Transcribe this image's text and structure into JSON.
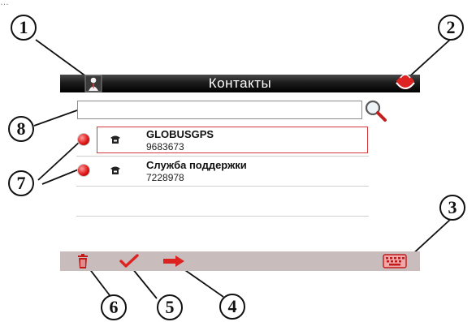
{
  "header": {
    "title": "Контакты",
    "cutoff_text": "…"
  },
  "search": {
    "value": "",
    "placeholder": ""
  },
  "contacts": [
    {
      "name": "GLOBUSGPS",
      "number": "9683673",
      "selected": true
    },
    {
      "name": "Служба поддержки",
      "number": "7228978",
      "selected": false
    }
  ],
  "callouts": [
    "1",
    "2",
    "3",
    "4",
    "5",
    "6",
    "7",
    "8"
  ],
  "icons": {
    "header_left": "person-icon",
    "header_right": "close-icon",
    "search": "search-icon",
    "contact_type": "phone-icon",
    "toolbar": [
      "trash-icon",
      "checkmark-icon",
      "arrow-right-icon",
      "keyboard-icon"
    ]
  },
  "colors": {
    "accent": "#d63a3a",
    "toolbar": "#c9bcbc",
    "titlebar": "#1c1c1c"
  }
}
